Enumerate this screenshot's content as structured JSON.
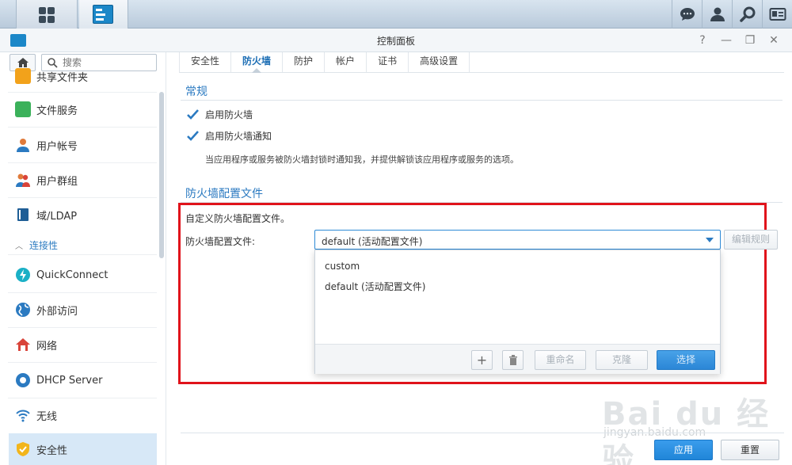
{
  "window": {
    "title": "控制面板",
    "controls": [
      "?",
      "—",
      "❐",
      "✕"
    ]
  },
  "taskbar": {
    "icons": [
      "chat-icon",
      "user-icon",
      "search-icon",
      "id-card-icon"
    ]
  },
  "sidebar": {
    "search_placeholder": "搜索",
    "items": [
      {
        "label": "共享文件夹",
        "icon": "shared-folder-icon",
        "color": "#f2a21b"
      },
      {
        "label": "文件服务",
        "icon": "file-services-icon",
        "color": "#3bb15a"
      },
      {
        "label": "用户帐号",
        "icon": "user-icon",
        "color": "#e07a3a"
      },
      {
        "label": "用户群组",
        "icon": "group-icon",
        "color": "#e07a3a"
      },
      {
        "label": "域/LDAP",
        "icon": "ldap-icon",
        "color": "#2b7ac1"
      },
      {
        "label": "QuickConnect",
        "icon": "quickconnect-icon",
        "color": "#1ab0c6"
      },
      {
        "label": "外部访问",
        "icon": "globe-icon",
        "color": "#2b7ac1"
      },
      {
        "label": "网络",
        "icon": "network-icon",
        "color": "#d9443a"
      },
      {
        "label": "DHCP Server",
        "icon": "dhcp-icon",
        "color": "#2b7ac1"
      },
      {
        "label": "无线",
        "icon": "wifi-icon",
        "color": "#2b7ac1"
      },
      {
        "label": "安全性",
        "icon": "shield-icon",
        "color": "#f2b51b"
      }
    ],
    "section_connectivity": "连接性"
  },
  "tabs": [
    "安全性",
    "防火墙",
    "防护",
    "帐户",
    "证书",
    "高级设置"
  ],
  "active_tab": "防火墙",
  "general": {
    "title": "常规",
    "enable_firewall": "启用防火墙",
    "enable_notify": "启用防火墙通知",
    "note": "当应用程序或服务被防火墙封锁时通知我，并提供解锁该应用程序或服务的选项。"
  },
  "profile": {
    "title": "防火墙配置文件",
    "description": "自定义防火墙配置文件。",
    "label": "防火墙配置文件:",
    "selected": "default (活动配置文件)",
    "edit_rules": "编辑规则",
    "options": [
      "custom",
      "default (活动配置文件)"
    ],
    "footer": {
      "rename": "重命名",
      "clone": "克隆",
      "select": "选择"
    }
  },
  "footer": {
    "apply": "应用",
    "reset": "重置"
  },
  "watermark": {
    "main": "Bai du 经验",
    "sub": "jingyan.baidu.com"
  }
}
